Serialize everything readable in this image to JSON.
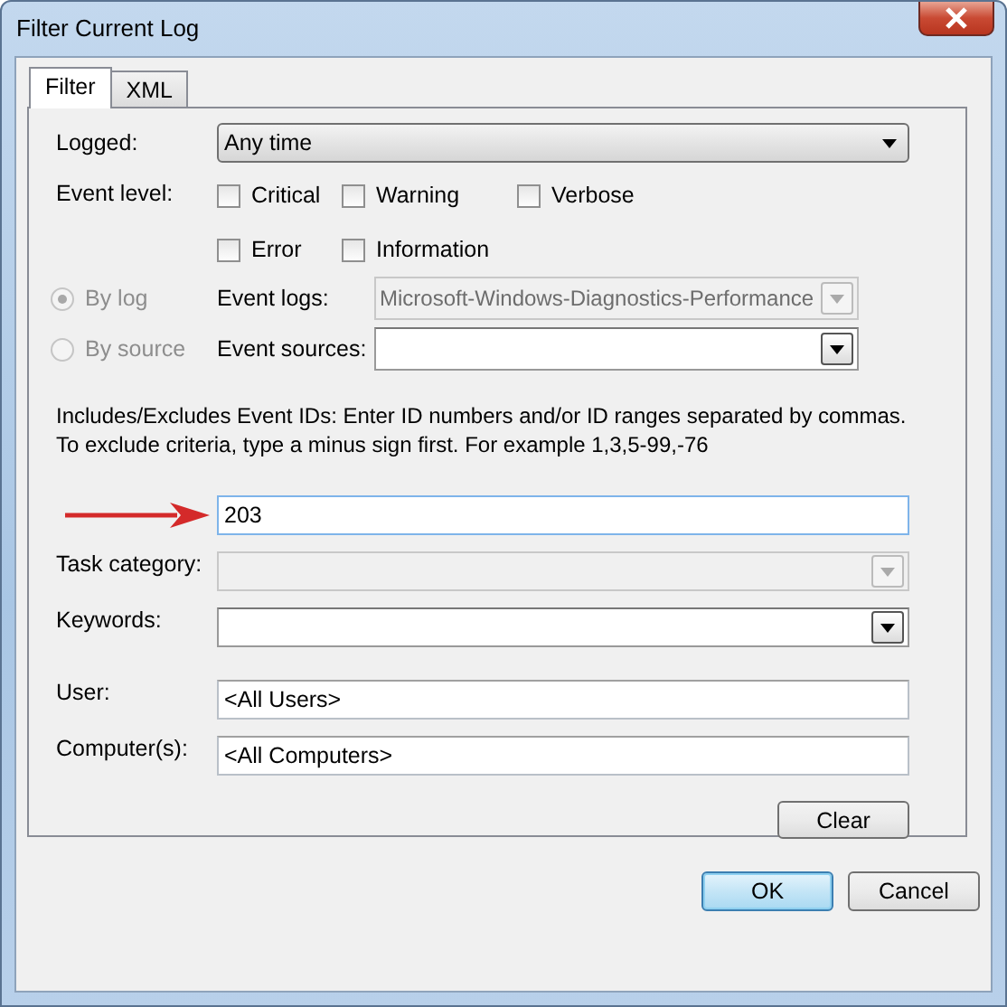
{
  "window": {
    "title": "Filter Current Log"
  },
  "tabs": [
    {
      "label": "Filter",
      "selected": true
    },
    {
      "label": "XML",
      "selected": false
    }
  ],
  "logged": {
    "label": "Logged:",
    "value": "Any time"
  },
  "event_level": {
    "label": "Event level:",
    "options": [
      {
        "label": "Critical",
        "checked": false
      },
      {
        "label": "Warning",
        "checked": false
      },
      {
        "label": "Verbose",
        "checked": false
      },
      {
        "label": "Error",
        "checked": false
      },
      {
        "label": "Information",
        "checked": false
      }
    ]
  },
  "sources": [
    {
      "radio": "By log",
      "selected": true,
      "radio_disabled": true,
      "label": "Event logs:",
      "value": "Microsoft-Windows-Diagnostics-Performance",
      "disabled": true
    },
    {
      "radio": "By source",
      "selected": false,
      "radio_disabled": true,
      "label": "Event sources:",
      "disabled": false
    }
  ],
  "event_ids": {
    "description": "Includes/Excludes Event IDs: Enter ID numbers and/or ID ranges separated by commas. To exclude criteria, type a minus sign first. For example 1,3,5-99,-76",
    "value": "203"
  },
  "fields": [
    {
      "kind": "combo",
      "label": "Task category:",
      "disabled": true
    },
    {
      "kind": "combo",
      "label": "Keywords:",
      "disabled": false
    },
    {
      "kind": "text",
      "label": "User:",
      "value": "<All Users>"
    },
    {
      "kind": "text",
      "label": "Computer(s):",
      "value": "<All Computers>"
    }
  ],
  "clear_button": "Clear",
  "buttons": [
    {
      "label": "OK",
      "default": true
    },
    {
      "label": "Cancel",
      "default": false
    }
  ]
}
